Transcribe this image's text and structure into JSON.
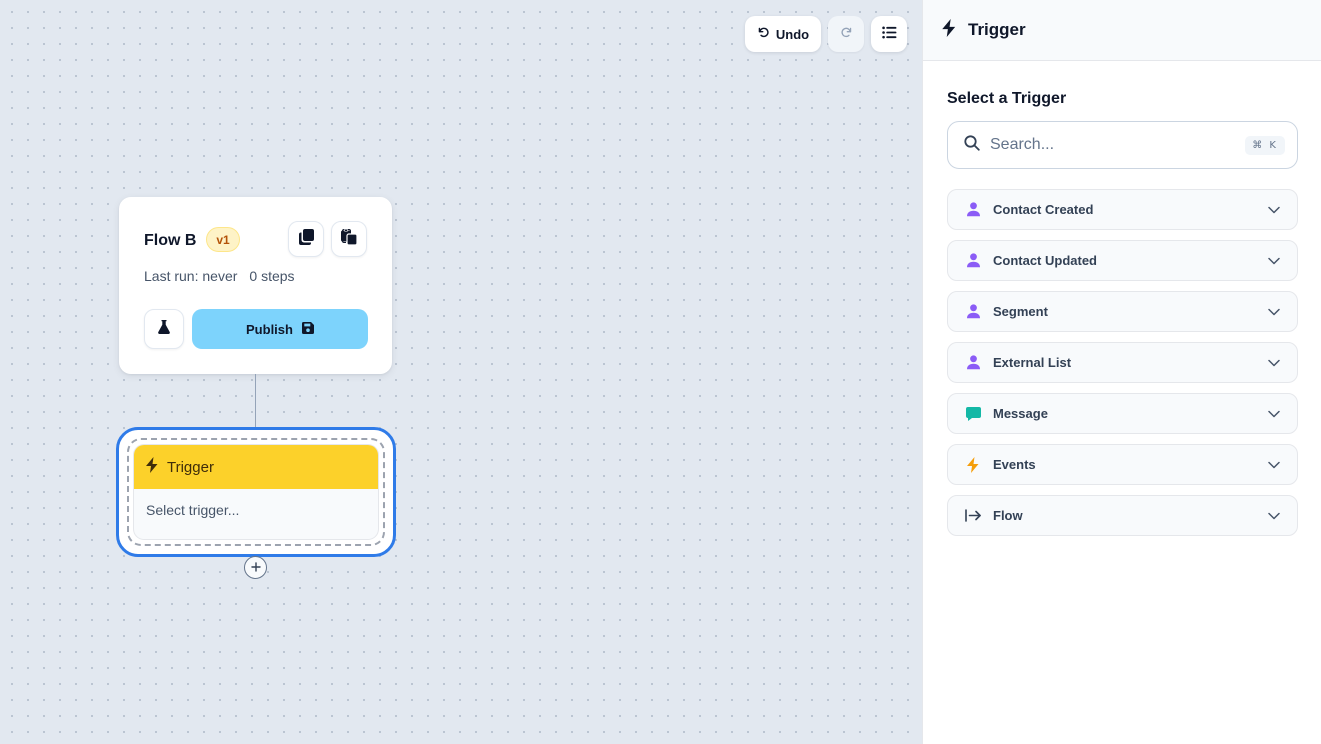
{
  "toolbar": {
    "undo_label": "Undo"
  },
  "flow": {
    "name": "Flow B",
    "version": "v1",
    "last_run": "Last run: never",
    "steps": "0 steps",
    "publish_label": "Publish"
  },
  "trigger_node": {
    "title": "Trigger",
    "placeholder": "Select trigger..."
  },
  "panel": {
    "title": "Trigger",
    "subtitle": "Select a Trigger",
    "search_placeholder": "Search...",
    "shortcut": "⌘ K",
    "items": [
      {
        "label": "Contact Created",
        "icon": "user-icon"
      },
      {
        "label": "Contact Updated",
        "icon": "user-icon"
      },
      {
        "label": "Segment",
        "icon": "user-icon"
      },
      {
        "label": "External List",
        "icon": "user-icon"
      },
      {
        "label": "Message",
        "icon": "message-icon"
      },
      {
        "label": "Events",
        "icon": "bolt-icon"
      },
      {
        "label": "Flow",
        "icon": "arrow-right-to-bar-icon"
      }
    ]
  },
  "colors": {
    "accent": "#2f7be8",
    "trigger_header": "#fcd12a",
    "publish": "#7dd3fc",
    "user_icon": "#8b5cf6",
    "message_icon": "#14b8a6",
    "bolt_icon": "#f59e0b"
  }
}
